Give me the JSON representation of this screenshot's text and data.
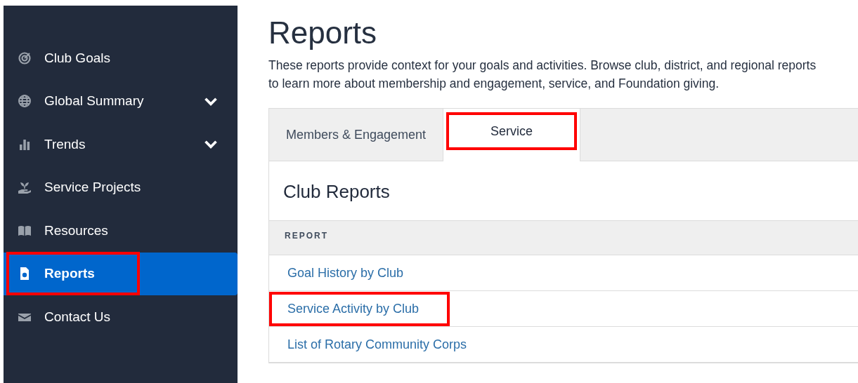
{
  "sidebar": {
    "items": [
      {
        "label": "Club Goals",
        "kind": "target",
        "expandable": false,
        "selected": false,
        "highlighted": false
      },
      {
        "label": "Global Summary",
        "kind": "globe",
        "expandable": true,
        "selected": false,
        "highlighted": false
      },
      {
        "label": "Trends",
        "kind": "bars",
        "expandable": true,
        "selected": false,
        "highlighted": false
      },
      {
        "label": "Service Projects",
        "kind": "plant",
        "expandable": false,
        "selected": false,
        "highlighted": false
      },
      {
        "label": "Resources",
        "kind": "book",
        "expandable": false,
        "selected": false,
        "highlighted": false
      },
      {
        "label": "Reports",
        "kind": "document",
        "expandable": false,
        "selected": true,
        "highlighted": true
      },
      {
        "label": "Contact Us",
        "kind": "envelope",
        "expandable": false,
        "selected": false,
        "highlighted": false
      }
    ]
  },
  "page": {
    "title": "Reports",
    "description": "These reports provide context for your goals and activities. Browse club, district, and regional reports to learn more about membership and engagement, service, and Foundation giving."
  },
  "tabs": [
    {
      "label": "Members & Engagement",
      "selected": false,
      "highlighted": false
    },
    {
      "label": "Service",
      "selected": true,
      "highlighted": true
    }
  ],
  "section": {
    "title": "Club Reports",
    "table": {
      "columns": [
        "REPORT"
      ],
      "rows": [
        {
          "label": "Goal History by Club",
          "highlighted": false
        },
        {
          "label": "Service Activity by Club",
          "highlighted": true
        },
        {
          "label": "List of Rotary Community Corps",
          "highlighted": false
        }
      ]
    }
  }
}
